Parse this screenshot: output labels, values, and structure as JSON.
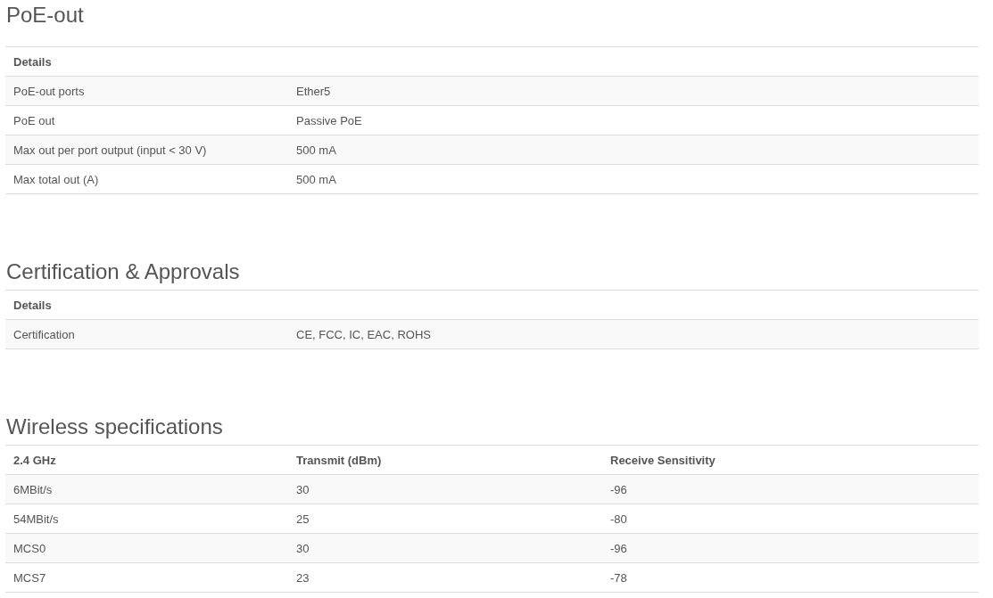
{
  "sections": [
    {
      "title": "PoE-out",
      "columns": [
        "Details"
      ],
      "rows": [
        [
          "PoE-out ports",
          "Ether5"
        ],
        [
          "PoE out",
          "Passive PoE"
        ],
        [
          "Max out per port output (input < 30 V)",
          "500 mA"
        ],
        [
          "Max total out (A)",
          "500 mA"
        ]
      ]
    },
    {
      "title": "Certification & Approvals",
      "columns": [
        "Details"
      ],
      "rows": [
        [
          "Certification",
          "CE, FCC, IC, EAC, ROHS"
        ]
      ]
    },
    {
      "title": "Wireless specifications",
      "columns": [
        "2.4 GHz",
        "Transmit (dBm)",
        "Receive Sensitivity"
      ],
      "rows": [
        [
          "6MBit/s",
          "30",
          "-96"
        ],
        [
          "54MBit/s",
          "25",
          "-80"
        ],
        [
          "MCS0",
          "30",
          "-96"
        ],
        [
          "MCS7",
          "23",
          "-78"
        ]
      ]
    }
  ]
}
